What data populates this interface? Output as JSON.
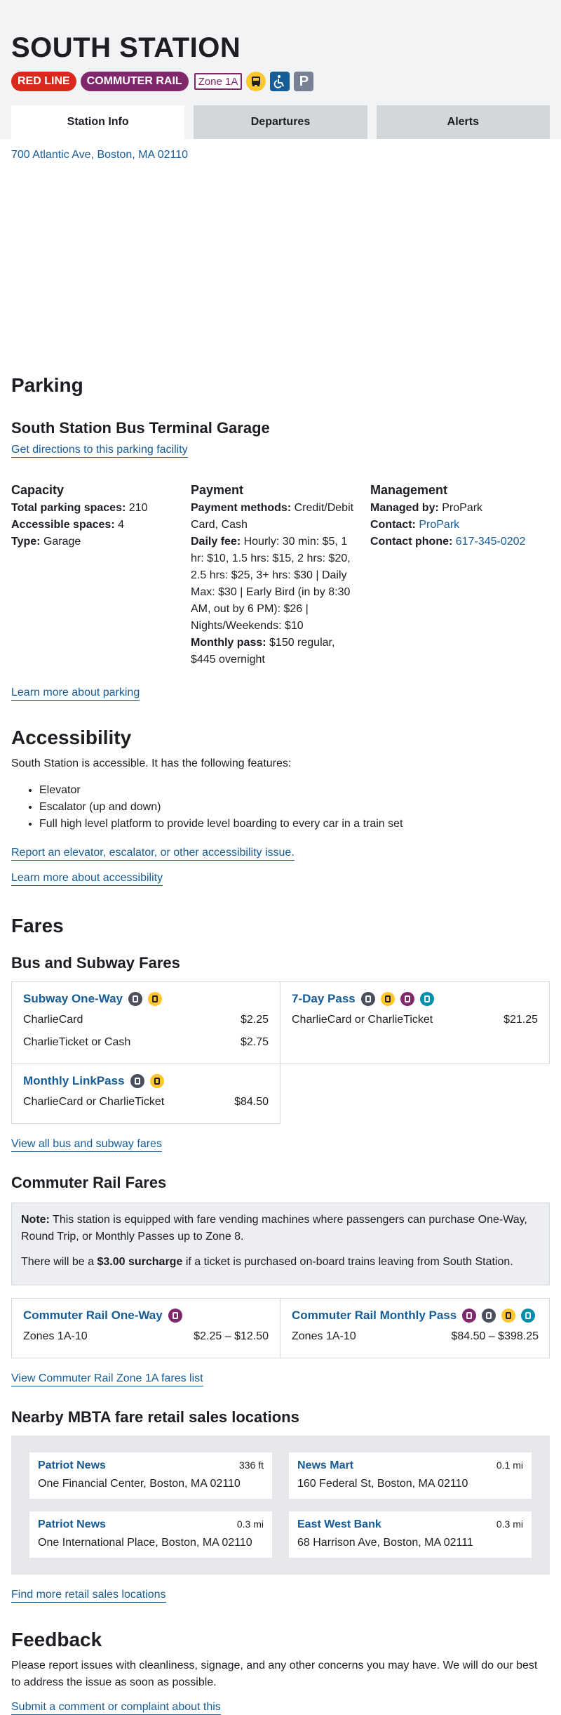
{
  "station": {
    "name": "SOUTH STATION",
    "badges": {
      "red_line": "RED LINE",
      "commuter_rail": "COMMUTER RAIL",
      "zone": "Zone 1A",
      "parking": "P"
    },
    "icons": [
      "bus-icon",
      "accessible-icon",
      "parking-icon"
    ],
    "colors": {
      "red_line": "#da291c",
      "commuter_rail": "#80276c",
      "bus": "#ffc72c",
      "link": "#165c96",
      "accessible": "#165c96",
      "parking": "#788093"
    }
  },
  "tabs": [
    {
      "label": "Station Info",
      "active": true
    },
    {
      "label": "Departures",
      "active": false
    },
    {
      "label": "Alerts",
      "active": false
    }
  ],
  "address": "700 Atlantic Ave, Boston, MA 02110",
  "parking": {
    "heading": "Parking",
    "facility_name": "South Station Bus Terminal Garage",
    "directions_link": "Get directions to this parking facility",
    "capacity": {
      "heading": "Capacity",
      "total_label": "Total parking spaces:",
      "total_value": "210",
      "accessible_label": "Accessible spaces:",
      "accessible_value": "4",
      "type_label": "Type:",
      "type_value": "Garage"
    },
    "payment": {
      "heading": "Payment",
      "methods_label": "Payment methods:",
      "methods_value": "Credit/Debit Card, Cash",
      "daily_label": "Daily fee:",
      "daily_value": "Hourly: 30 min: $5, 1 hr: $10, 1.5 hrs: $15, 2 hrs: $20, 2.5 hrs: $25, 3+ hrs: $30 | Daily Max: $30 | Early Bird (in by 8:30 AM, out by 6 PM): $26 | Nights/Weekends: $10",
      "monthly_label": "Monthly pass:",
      "monthly_value": "$150 regular, $445 overnight"
    },
    "management": {
      "heading": "Management",
      "managed_label": "Managed by:",
      "managed_value": "ProPark",
      "contact_label": "Contact:",
      "contact_value": "ProPark",
      "phone_label": "Contact phone:",
      "phone_value": "617-345-0202"
    },
    "learn_more": "Learn more about parking"
  },
  "accessibility": {
    "heading": "Accessibility",
    "intro": "South Station is accessible. It has the following features:",
    "features": [
      "Elevator",
      "Escalator (up and down)",
      "Full high level platform to provide level boarding to every car in a train set"
    ],
    "report_link": "Report an elevator, escalator, or other accessibility issue.",
    "learn_more": "Learn more about accessibility"
  },
  "fares": {
    "heading": "Fares",
    "bus_subway": {
      "heading": "Bus and Subway Fares",
      "cards": [
        {
          "title": "Subway One-Way",
          "rows": [
            [
              "CharlieCard",
              "$2.25"
            ],
            [
              "CharlieTicket or Cash",
              "$2.75"
            ]
          ]
        },
        {
          "title": "7-Day Pass",
          "rows": [
            [
              "CharlieCard or CharlieTicket",
              "$21.25"
            ]
          ]
        },
        {
          "title": "Monthly LinkPass",
          "rows": [
            [
              "CharlieCard or CharlieTicket",
              "$84.50"
            ]
          ]
        }
      ],
      "view_all": "View all bus and subway fares"
    },
    "commuter_rail": {
      "heading": "Commuter Rail Fares",
      "note_label": "Note:",
      "note_text": "This station is equipped with fare vending machines where passengers can purchase One-Way, Round Trip, or Monthly Passes up to Zone 8.",
      "surcharge_pre": "There will be a",
      "surcharge_amount": "$3.00 surcharge",
      "surcharge_post": "if a ticket is purchased on-board trains leaving from South Station.",
      "cards": [
        {
          "title": "Commuter Rail One-Way",
          "rows": [
            [
              "Zones 1A-10",
              "$2.25 – $12.50"
            ]
          ]
        },
        {
          "title": "Commuter Rail Monthly Pass",
          "rows": [
            [
              "Zones 1A-10",
              "$84.50 – $398.25"
            ]
          ]
        }
      ],
      "view_link": "View Commuter Rail Zone 1A fares list"
    },
    "retail": {
      "heading": "Nearby MBTA fare retail sales locations",
      "locations": [
        {
          "name": "Patriot News",
          "distance": "336 ft",
          "address": "One Financial Center, Boston, MA 02110"
        },
        {
          "name": "News Mart",
          "distance": "0.1 mi",
          "address": "160 Federal St, Boston, MA 02110"
        },
        {
          "name": "Patriot News",
          "distance": "0.3 mi",
          "address": "One International Place, Boston, MA 02110"
        },
        {
          "name": "East West Bank",
          "distance": "0.3 mi",
          "address": "68 Harrison Ave, Boston, MA 02111"
        }
      ],
      "find_more": "Find more retail sales locations"
    }
  },
  "feedback": {
    "heading": "Feedback",
    "text": "Please report issues with cleanliness, signage, and any other concerns you may have. We will do our best to address the issue as soon as possible.",
    "link": "Submit a comment or complaint about this"
  }
}
